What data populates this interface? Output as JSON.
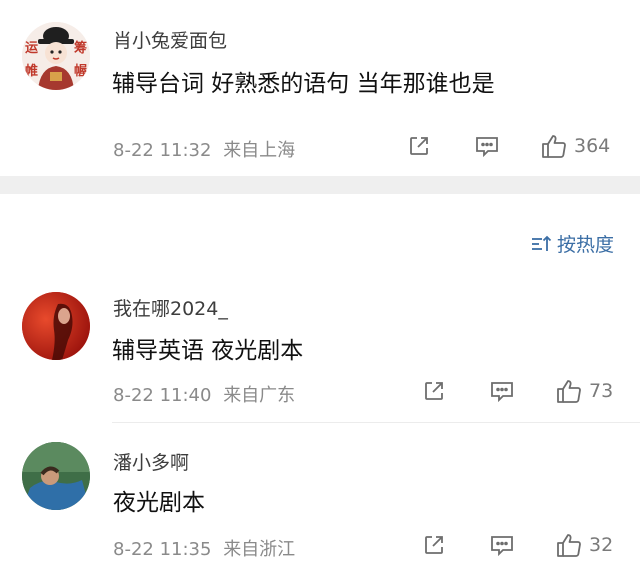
{
  "comments": [
    {
      "username": "肖小兔爱面包",
      "text": "辅导台词  好熟悉的语句 当年那谁也是",
      "date_time": "8-22 11:32",
      "location": "来自上海",
      "likes": "364",
      "avatar_text": [
        "运",
        "筹",
        "帷",
        "幄"
      ]
    },
    {
      "username": "我在哪2024_",
      "text": "辅导英语  夜光剧本",
      "date_time": "8-22 11:40",
      "location": "来自广东",
      "likes": "73"
    },
    {
      "username": "潘小多啊",
      "text": "夜光剧本",
      "date_time": "8-22 11:35",
      "location": "来自浙江",
      "likes": "32"
    }
  ],
  "sort": {
    "label": "按热度"
  },
  "icons": {
    "share": "share-icon",
    "comment": "comment-icon",
    "like": "thumb-up-icon",
    "sort": "sort-icon"
  },
  "colors": {
    "accent_link": "#3b6ea5",
    "separator": "#efefef",
    "meta_text": "#8a8a8a"
  }
}
